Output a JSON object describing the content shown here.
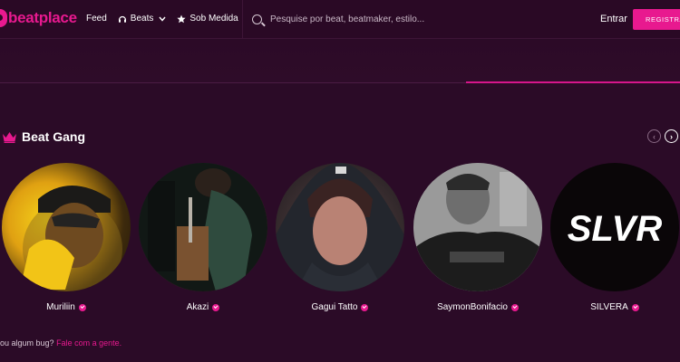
{
  "header": {
    "logo_text": "beatplace",
    "nav": [
      {
        "label": "Feed",
        "icon": ""
      },
      {
        "label": "Beats",
        "icon": "headphones-icon"
      },
      {
        "label": "Sob Medida",
        "icon": "star-icon"
      }
    ],
    "search_placeholder": "Pesquise por beat, beatmaker, estilo...",
    "login_label": "Entrar",
    "register_label": "REGISTRAR"
  },
  "section": {
    "title": "Beat Gang",
    "icon": "crown-icon",
    "prev_icon": "‹",
    "next_icon": "›",
    "artists": [
      {
        "name": "Muriliin",
        "verified": true
      },
      {
        "name": "Akazi",
        "verified": true
      },
      {
        "name": "Gagui Tatto",
        "verified": true
      },
      {
        "name": "SaymonBonifacio",
        "verified": true
      },
      {
        "name": "SILVERA",
        "verified": true,
        "logo_text": "SLVR"
      }
    ]
  },
  "footer": {
    "bug_text": "ou algum bug?",
    "bug_link": "Fale com a gente."
  },
  "colors": {
    "background": "#2b0b27",
    "accent": "#e8198f"
  }
}
